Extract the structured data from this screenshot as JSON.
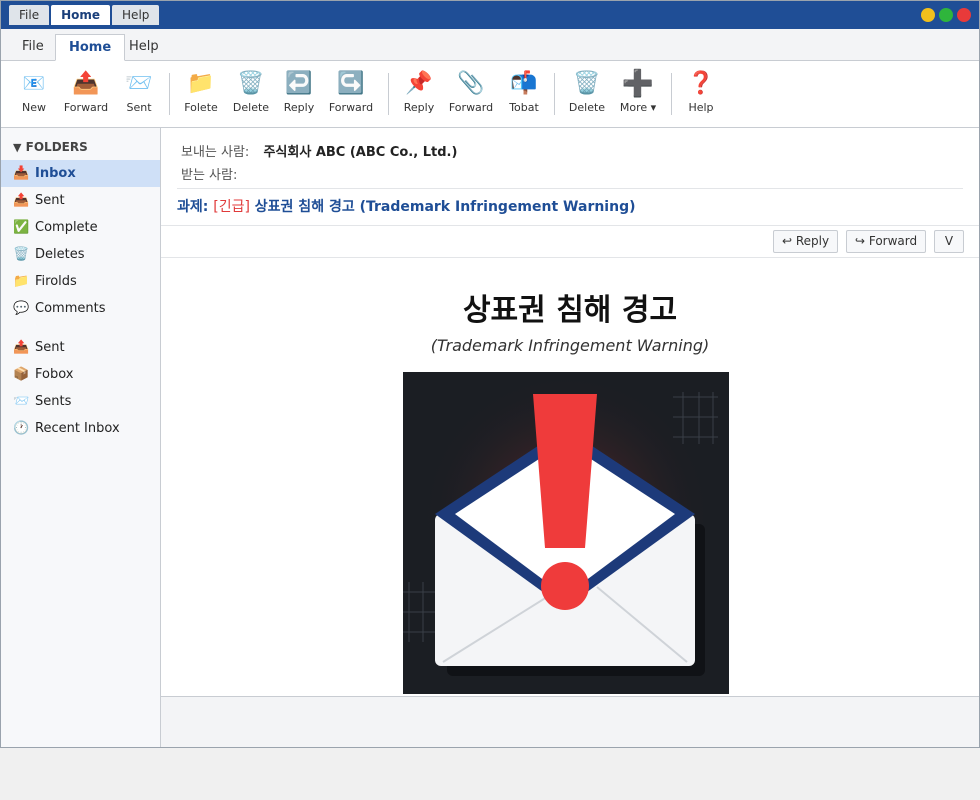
{
  "titlebar": {
    "tabs": [
      "File",
      "Home",
      "Help"
    ],
    "controls": {
      "minimize_color": "#f2c01c",
      "maximize_color": "#2fb53c",
      "close_color": "#e83a3a"
    }
  },
  "ribbon": {
    "tabs": [
      "File",
      "Home",
      "Help"
    ]
  },
  "toolbar": {
    "buttons": [
      {
        "label": "New",
        "icon": "new-mail-icon"
      },
      {
        "label": "Forward",
        "icon": "outbox-tray-icon"
      },
      {
        "label": "Sent",
        "icon": "incoming-envelope-icon"
      },
      {
        "label": "Folete",
        "icon": "folder-icon"
      },
      {
        "label": "Delete",
        "icon": "trash-icon"
      },
      {
        "label": "Reply",
        "icon": "reply-arrow-icon"
      },
      {
        "label": "Forward",
        "icon": "forward-arrow-icon"
      },
      {
        "label": "Reply",
        "icon": "pin-icon"
      },
      {
        "label": "Forward",
        "icon": "paperclip-icon"
      },
      {
        "label": "Tobat",
        "icon": "mailbox-icon"
      },
      {
        "label": "Delete",
        "icon": "trash-icon"
      },
      {
        "label": "More ▾",
        "icon": "plus-icon"
      },
      {
        "label": "Help",
        "icon": "question-icon"
      }
    ]
  },
  "sidebar": {
    "heading": "FOLDERS",
    "items": [
      {
        "label": "Inbox",
        "icon": "📥",
        "active": true
      },
      {
        "label": "Sent",
        "icon": "📤"
      },
      {
        "label": "Complete",
        "icon": "✅"
      },
      {
        "label": "Deletes",
        "icon": "🗑️"
      },
      {
        "label": "Firolds",
        "icon": "📁"
      },
      {
        "label": "Comments",
        "icon": "💬"
      },
      {
        "label": "Sent",
        "icon": "📤"
      },
      {
        "label": "Fobox",
        "icon": "📦"
      },
      {
        "label": "Sents",
        "icon": "📨"
      },
      {
        "label": "Recent Inbox",
        "icon": "🕐"
      }
    ]
  },
  "message": {
    "from_label": "보내는 사람:",
    "from_value": "주식회사 ABC (ABC Co., Ltd.)",
    "to_label": "받는 사람:",
    "subject_prefix": "과제:",
    "subject_urgent": "[긴급]",
    "subject_text": "상표권 침해 경고 (Trademark Infringement Warning)",
    "actions": {
      "reply": "↩ Reply",
      "forward": "↪ Forward",
      "more": "V"
    },
    "body_title": "상표권 침해 경고",
    "body_subtitle": "(Trademark Infringement Warning)"
  },
  "colors": {
    "accent": "#1f4e96",
    "urgent": "#e03a3a",
    "selected_bg": "#cfe0f7"
  }
}
